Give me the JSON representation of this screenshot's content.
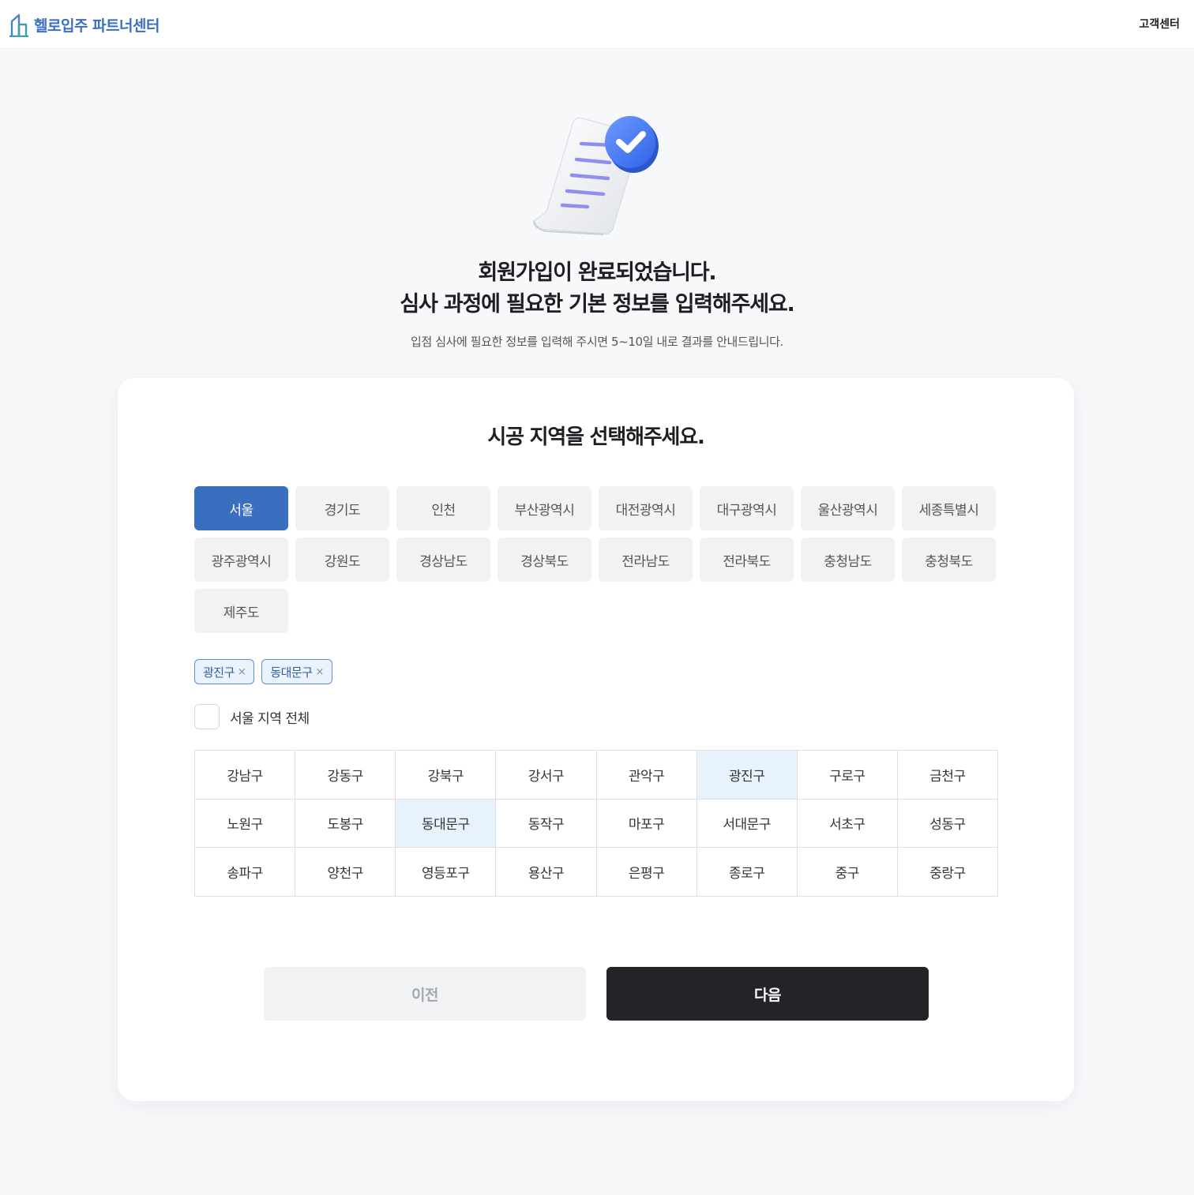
{
  "header": {
    "brand": "헬로입주 파트너센터",
    "support": "고객센터"
  },
  "hero": {
    "title_line1": "회원가입이 완료되었습니다.",
    "title_line2": "심사 과정에 필요한 기본 정보를 입력해주세요.",
    "subtitle": "입점 심사에 필요한 정보를 입력해 주시면 5~10일 내로 결과를 안내드립니다."
  },
  "card": {
    "title": "시공 지역을 선택해주세요.",
    "regions": [
      {
        "label": "서울",
        "active": true
      },
      {
        "label": "경기도",
        "active": false
      },
      {
        "label": "인천",
        "active": false
      },
      {
        "label": "부산광역시",
        "active": false
      },
      {
        "label": "대전광역시",
        "active": false
      },
      {
        "label": "대구광역시",
        "active": false
      },
      {
        "label": "울산광역시",
        "active": false
      },
      {
        "label": "세종특별시",
        "active": false
      },
      {
        "label": "광주광역시",
        "active": false
      },
      {
        "label": "강원도",
        "active": false
      },
      {
        "label": "경상남도",
        "active": false
      },
      {
        "label": "경상북도",
        "active": false
      },
      {
        "label": "전라남도",
        "active": false
      },
      {
        "label": "전라북도",
        "active": false
      },
      {
        "label": "충청남도",
        "active": false
      },
      {
        "label": "충청북도",
        "active": false
      },
      {
        "label": "제주도",
        "active": false
      }
    ],
    "selected_chips": [
      {
        "label": "광진구",
        "remove": "×"
      },
      {
        "label": "동대문구",
        "remove": "×"
      }
    ],
    "select_all_label": "서울 지역 전체",
    "select_all_checked": false,
    "districts": [
      {
        "label": "강남구",
        "selected": false
      },
      {
        "label": "강동구",
        "selected": false
      },
      {
        "label": "강북구",
        "selected": false
      },
      {
        "label": "강서구",
        "selected": false
      },
      {
        "label": "관악구",
        "selected": false
      },
      {
        "label": "광진구",
        "selected": true
      },
      {
        "label": "구로구",
        "selected": false
      },
      {
        "label": "금천구",
        "selected": false
      },
      {
        "label": "노원구",
        "selected": false
      },
      {
        "label": "도봉구",
        "selected": false
      },
      {
        "label": "동대문구",
        "selected": true
      },
      {
        "label": "동작구",
        "selected": false
      },
      {
        "label": "마포구",
        "selected": false
      },
      {
        "label": "서대문구",
        "selected": false
      },
      {
        "label": "서초구",
        "selected": false
      },
      {
        "label": "성동구",
        "selected": false
      },
      {
        "label": "송파구",
        "selected": false
      },
      {
        "label": "양천구",
        "selected": false
      },
      {
        "label": "영등포구",
        "selected": false
      },
      {
        "label": "용산구",
        "selected": false
      },
      {
        "label": "은평구",
        "selected": false
      },
      {
        "label": "종로구",
        "selected": false
      },
      {
        "label": "중구",
        "selected": false
      },
      {
        "label": "중랑구",
        "selected": false
      }
    ],
    "prev_label": "이전",
    "next_label": "다음"
  },
  "colors": {
    "brand": "#3a6fbf",
    "selected_cell": "#e8f2fc",
    "primary_button": "#232428"
  },
  "icons": {
    "logo": "building-logo-icon",
    "illustration": "document-check-icon",
    "chip_remove": "close-icon"
  }
}
